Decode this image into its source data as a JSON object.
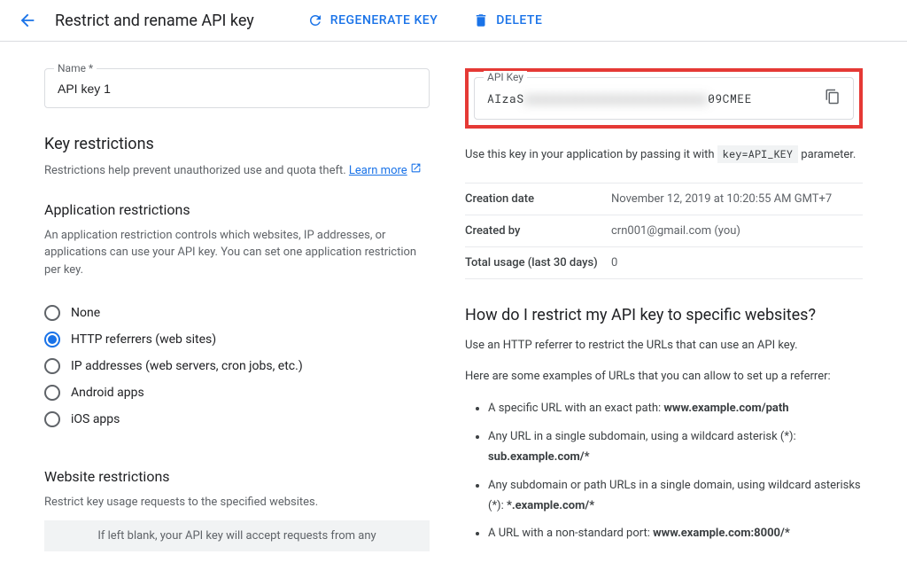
{
  "header": {
    "title": "Restrict and rename API key",
    "regenerate": "REGENERATE KEY",
    "delete": "DELETE"
  },
  "name_field": {
    "label": "Name *",
    "value": "API key 1"
  },
  "key_restrictions": {
    "heading": "Key restrictions",
    "desc": "Restrictions help prevent unauthorized use and quota theft. ",
    "learn_more": "Learn more"
  },
  "app_restrictions": {
    "heading": "Application restrictions",
    "desc": "An application restriction controls which websites, IP addresses, or applications can use your API key. You can set one application restriction per key.",
    "options": [
      {
        "label": "None",
        "selected": false
      },
      {
        "label": "HTTP referrers (web sites)",
        "selected": true
      },
      {
        "label": "IP addresses (web servers, cron jobs, etc.)",
        "selected": false
      },
      {
        "label": "Android apps",
        "selected": false
      },
      {
        "label": "iOS apps",
        "selected": false
      }
    ]
  },
  "website_restrictions": {
    "heading": "Website restrictions",
    "desc": "Restrict key usage requests to the specified websites.",
    "note_partial": "If left blank, your API key will accept requests from any"
  },
  "api_key": {
    "label": "API Key",
    "prefix": "AIzaS",
    "blurred": "xxxxxxxxxxxxxxxxxxxxxxxxx",
    "suffix": "09CMEE"
  },
  "help": {
    "text_pre": "Use this key in your application by passing it with ",
    "code": "key=API_KEY",
    "text_post": " parameter."
  },
  "info": {
    "rows": [
      {
        "key": "Creation date",
        "val": "November 12, 2019 at 10:20:55 AM GMT+7"
      },
      {
        "key": "Created by",
        "val": "crn001@gmail.com (you)"
      },
      {
        "key": "Total usage (last 30 days)",
        "val": "0"
      }
    ]
  },
  "faq": {
    "heading": "How do I restrict my API key to specific websites?",
    "p1": "Use an HTTP referrer to restrict the URLs that can use an API key.",
    "p2": "Here are some examples of URLs that you can allow to set up a referrer:",
    "items": [
      {
        "text": "A specific URL with an exact path: ",
        "bold": "www.example.com/path"
      },
      {
        "text": "Any URL in a single subdomain, using a wildcard asterisk (*): ",
        "bold": "sub.example.com/*"
      },
      {
        "text": "Any subdomain or path URLs in a single domain, using wildcard asterisks (*): ",
        "bold": "*.example.com/*"
      },
      {
        "text": "A URL with a non-standard port: ",
        "bold": "www.example.com:8000/*"
      }
    ]
  }
}
